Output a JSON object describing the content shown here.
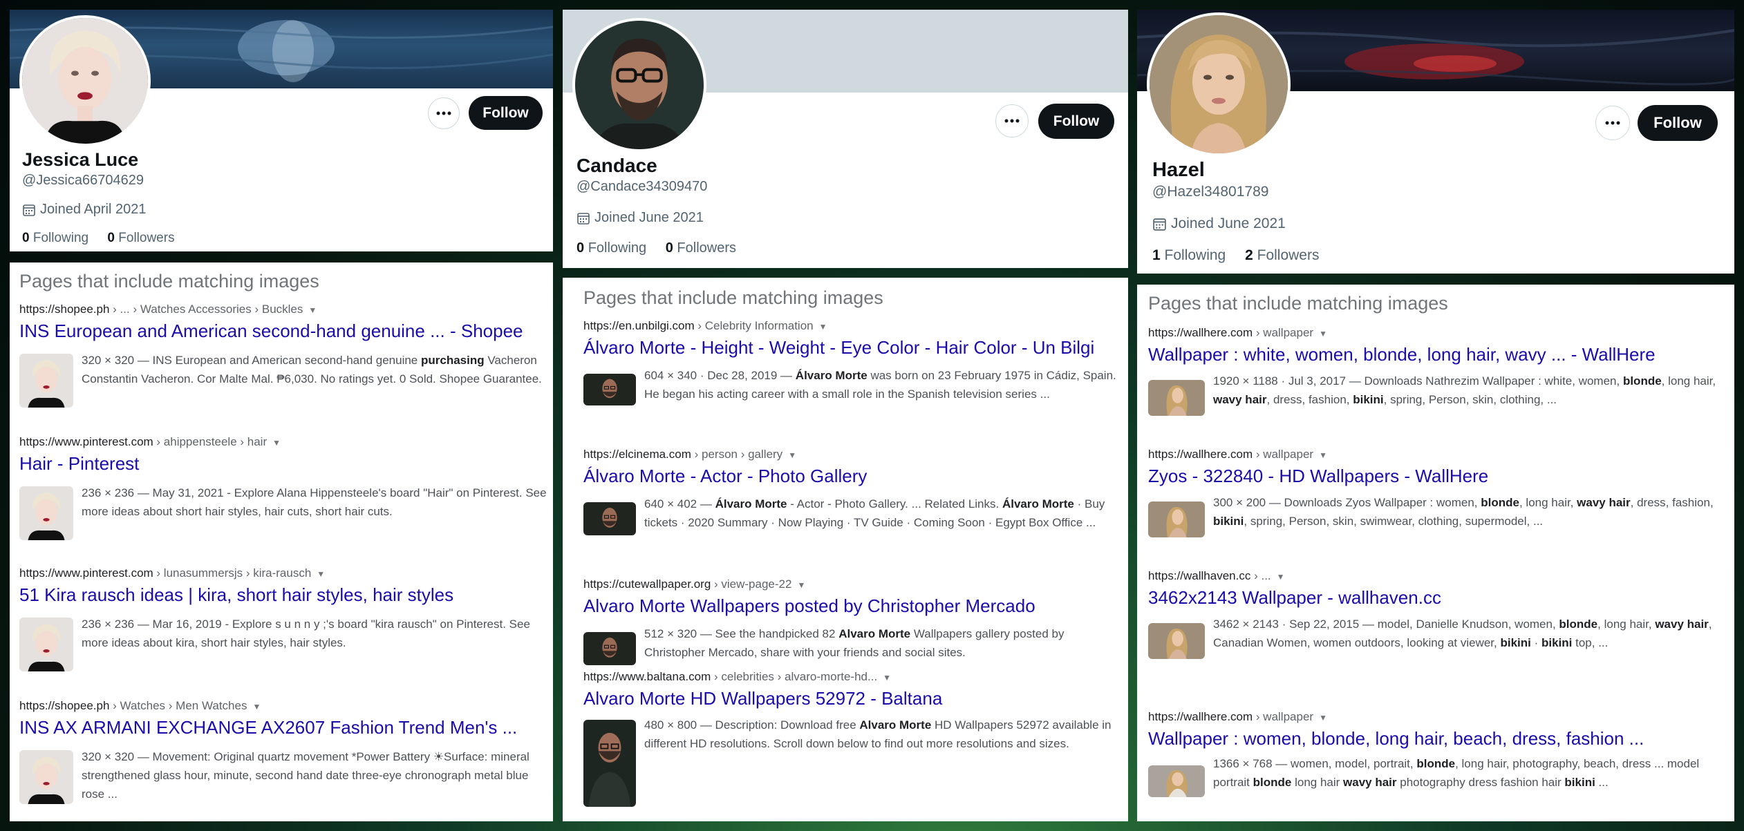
{
  "panels": [
    {
      "profile": {
        "name": "Jessica Luce",
        "handle": "@Jessica66704629",
        "joined": "Joined April 2021",
        "following_count": "0",
        "following_label": "Following",
        "followers_count": "0",
        "followers_label": "Followers",
        "follow_label": "Follow"
      },
      "results": {
        "heading": "Pages that include matching images",
        "items": [
          {
            "site": "https://shopee.ph",
            "path": " › ... › Watches Accessories › Buckles",
            "title": "INS European and American second-hand genuine ... - Shopee",
            "snippet": "320 × 320 — INS European and American second-hand genuine <b>purchasing</b> Vacheron Constantin Vacheron. Cor Malte Mal. ₱6,030. No ratings yet. 0 Sold. Shopee Guarantee."
          },
          {
            "site": "https://www.pinterest.com",
            "path": " › ahippensteele › hair",
            "title": "Hair - Pinterest",
            "snippet": "236 × 236 — May 31, 2021 - Explore Alana Hippensteele's board \"Hair\" on Pinterest. See more ideas about short hair styles, hair cuts, short hair cuts."
          },
          {
            "site": "https://www.pinterest.com",
            "path": " › lunasummersjs › kira-rausch",
            "title": "51 Kira rausch ideas | kira, short hair styles, hair styles",
            "snippet": "236 × 236 — Mar 16, 2019 - Explore s u n n y ;'s board \"kira rausch\" on Pinterest. See more ideas about kira, short hair styles, hair styles."
          },
          {
            "site": "https://shopee.ph",
            "path": " › Watches › Men Watches",
            "title": "INS AX ARMANI EXCHANGE AX2607 Fashion Trend Men's ...",
            "snippet": "320 × 320 — Movement: Original quartz movement *Power Battery ☀Surface: mineral strengthened glass hour, minute, second hand date three-eye chronograph metal blue rose ..."
          }
        ]
      }
    },
    {
      "profile": {
        "name": "Candace",
        "handle": "@Candace34309470",
        "joined": "Joined June 2021",
        "following_count": "0",
        "following_label": "Following",
        "followers_count": "0",
        "followers_label": "Followers",
        "follow_label": "Follow"
      },
      "results": {
        "heading": "Pages that include matching images",
        "items": [
          {
            "site": "https://en.unbilgi.com",
            "path": " › Celebrity Information",
            "title": "Álvaro Morte - Height - Weight - Eye Color - Hair Color - Un Bilgi",
            "snippet": "604 × 340 · Dec 28, 2019 — <b>Álvaro Morte</b> was born on 23 February 1975 in Cádiz, Spain. He began his acting career with a small role in the Spanish television series ..."
          },
          {
            "site": "https://elcinema.com",
            "path": " › person › gallery",
            "title": "Álvaro Morte - Actor - Photo Gallery",
            "snippet": "640 × 402 — <b>Álvaro Morte</b> - Actor - Photo Gallery. ... Related Links. <b>Álvaro Morte</b> · Buy tickets · 2020 Summary · Now Playing · TV Guide · Coming Soon · Egypt Box Office ..."
          },
          {
            "site": "https://cutewallpaper.org",
            "path": " › view-page-22",
            "title": "Alvaro Morte Wallpapers posted by Christopher Mercado",
            "snippet": "512 × 320 — See the handpicked 82 <b>Alvaro Morte</b> Wallpapers gallery posted by Christopher Mercado, share with your friends and social sites."
          },
          {
            "site": "https://www.baltana.com",
            "path": " › celebrities › alvaro-morte-hd...",
            "title": "Alvaro Morte HD Wallpapers 52972 - Baltana",
            "snippet": "480 × 800 — Description: Download free <b>Alvaro Morte</b> HD Wallpapers 52972 available in different HD resolutions. Scroll down below to find out more resolutions and sizes."
          }
        ]
      }
    },
    {
      "profile": {
        "name": "Hazel",
        "handle": "@Hazel34801789",
        "joined": "Joined June 2021",
        "following_count": "1",
        "following_label": "Following",
        "followers_count": "2",
        "followers_label": "Followers",
        "follow_label": "Follow"
      },
      "results": {
        "heading": "Pages that include matching images",
        "items": [
          {
            "site": "https://wallhere.com",
            "path": " › wallpaper",
            "title": "Wallpaper : white, women, blonde, long hair, wavy ... - WallHere",
            "snippet": "1920 × 1188 · Jul 3, 2017 — Downloads Nathrezim Wallpaper : white, women, <b>blonde</b>, long hair, <b>wavy hair</b>, dress, fashion, <b>bikini</b>, spring, Person, skin, clothing, ..."
          },
          {
            "site": "https://wallhere.com",
            "path": " › wallpaper",
            "title": "Zyos - 322840 - HD Wallpapers - WallHere",
            "snippet": "300 × 200 — Downloads Zyos Wallpaper : women, <b>blonde</b>, long hair, <b>wavy hair</b>, dress, fashion, <b>bikini</b>, spring, Person, skin, swimwear, clothing, supermodel, ..."
          },
          {
            "site": "https://wallhaven.cc",
            "path": " › ...",
            "title": "3462x2143 Wallpaper - wallhaven.cc",
            "snippet": "3462 × 2143 · Sep 22, 2015 — model, Danielle Knudson, women, <b>blonde</b>, long hair, <b>wavy hair</b>, Canadian Women, women outdoors, looking at viewer, <b>bikini</b> · <b>bikini</b> top, ..."
          },
          {
            "site": "https://wallhere.com",
            "path": " › wallpaper",
            "title": "Wallpaper : women, blonde, long hair, beach, dress, fashion ...",
            "snippet": "1366 × 768 — women, model, portrait, <b>blonde</b>, long hair, photography, beach, dress ... model portrait <b>blonde</b> long hair <b>wavy hair</b> photography dress fashion hair <b>bikini</b> ..."
          }
        ]
      }
    }
  ],
  "colors": {
    "follow_bg": "#0f1419",
    "link": "#1a0dab",
    "muted": "#536471",
    "banner_1": "#1f3f63",
    "banner_2": "#cfd9de",
    "banner_3": "#151b2c"
  },
  "icons": {
    "calendar": "calendar-icon",
    "more": "more-options-icon",
    "caret": "caret-down-icon"
  }
}
